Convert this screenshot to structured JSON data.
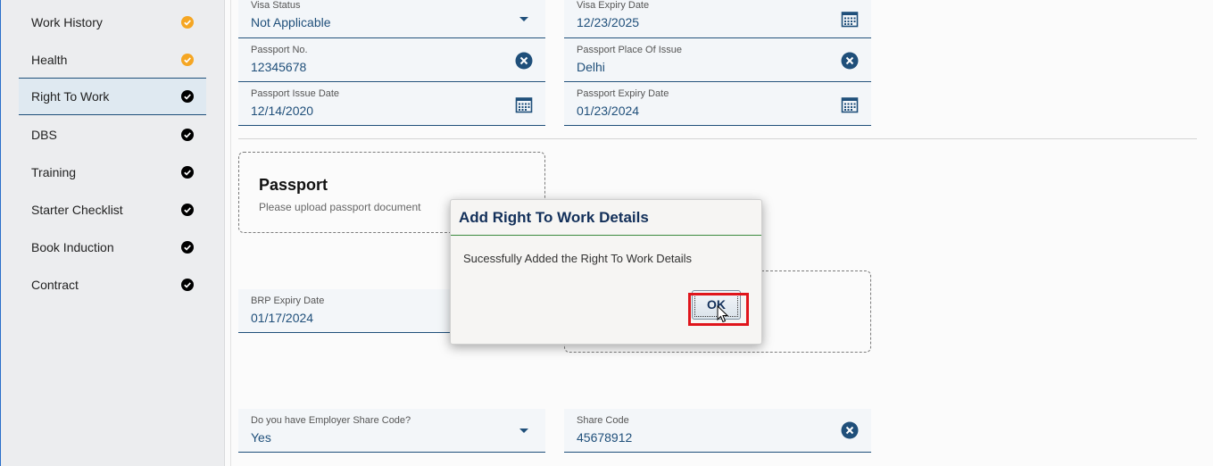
{
  "sidebar": {
    "items": [
      {
        "label": "Work History",
        "status": "pending",
        "active": false
      },
      {
        "label": "Health",
        "status": "pending",
        "active": false
      },
      {
        "label": "Right To Work",
        "status": "complete",
        "active": true
      },
      {
        "label": "DBS",
        "status": "complete",
        "active": false
      },
      {
        "label": "Training",
        "status": "complete",
        "active": false
      },
      {
        "label": "Starter Checklist",
        "status": "complete",
        "active": false
      },
      {
        "label": "Book Induction",
        "status": "complete",
        "active": false
      },
      {
        "label": "Contract",
        "status": "complete",
        "active": false
      }
    ]
  },
  "form": {
    "visa_status": {
      "label": "Visa Status",
      "value": "Not Applicable",
      "icon": "chevron-down-icon"
    },
    "visa_expiry": {
      "label": "Visa Expiry Date",
      "value": "12/23/2025",
      "icon": "calendar-icon"
    },
    "passport_no": {
      "label": "Passport No.",
      "value": "12345678",
      "icon": "clear-icon"
    },
    "passport_place": {
      "label": "Passport Place Of Issue",
      "value": "Delhi",
      "icon": "clear-icon"
    },
    "passport_issue": {
      "label": "Passport Issue Date",
      "value": "12/14/2020",
      "icon": "calendar-icon"
    },
    "passport_expiry": {
      "label": "Passport Expiry Date",
      "value": "01/23/2024",
      "icon": "calendar-icon"
    },
    "passport_upload": {
      "title": "Passport",
      "subtitle": "Please upload passport document"
    },
    "brp_expiry": {
      "label": "BRP Expiry Date",
      "value": "01/17/2024"
    },
    "share_code_q": {
      "label": "Do you have Employer Share Code?",
      "value": "Yes",
      "icon": "chevron-down-icon"
    },
    "share_code": {
      "label": "Share Code",
      "value": "45678912",
      "icon": "clear-icon"
    }
  },
  "dialog": {
    "title": "Add Right To Work Details",
    "message": "Sucessfully Added the Right To Work Details",
    "ok_label": "OK"
  },
  "colors": {
    "accent": "#1f4f7a",
    "pending": "#f5a623",
    "complete": "#000000",
    "highlight": "#e0151b"
  }
}
